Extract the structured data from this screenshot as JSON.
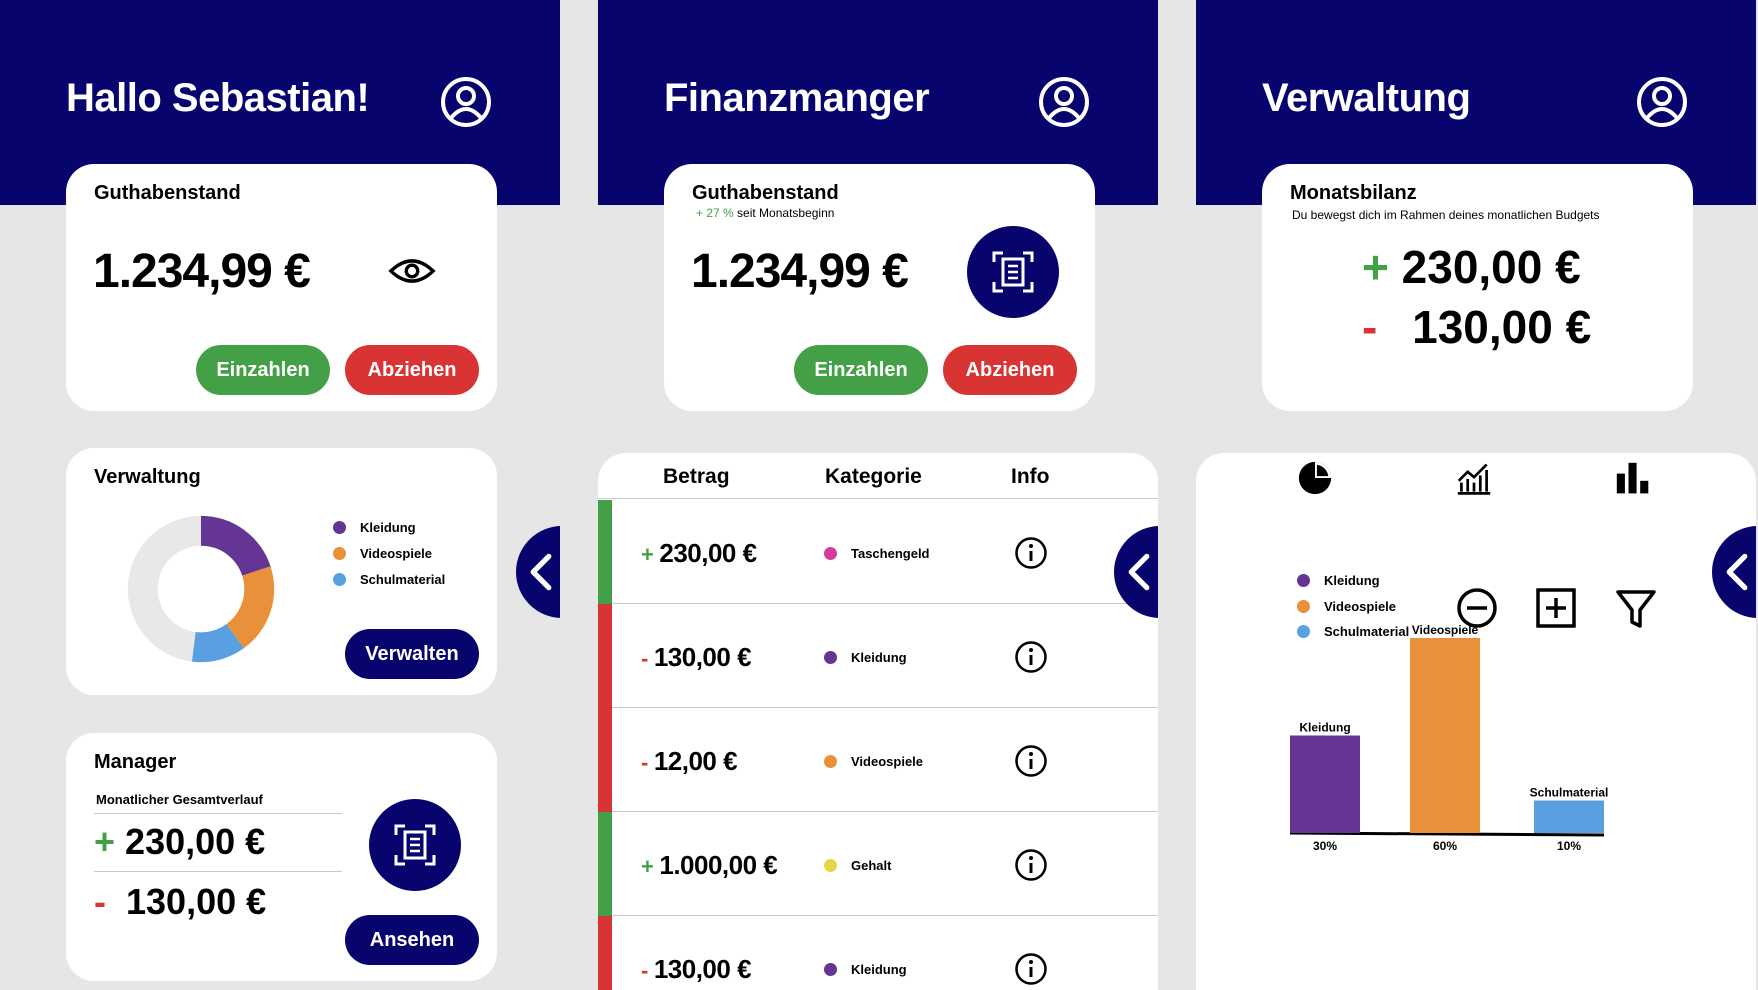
{
  "colors": {
    "navy": "#07046e",
    "green": "#43a047",
    "red": "#d93434",
    "purple": "#643594",
    "orange": "#e8913a",
    "blue": "#5aa0e0",
    "pink": "#d63a9c",
    "yellow": "#e5d745",
    "ring_bg": "#e8e8e8"
  },
  "screen1": {
    "title": "Hallo Sebastian!",
    "balance_card": {
      "title": "Guthabenstand",
      "amount": "1.234,99 €",
      "deposit_label": "Einzahlen",
      "withdraw_label": "Abziehen"
    },
    "admin_card": {
      "title": "Verwaltung",
      "legend": [
        {
          "label": "Kleidung",
          "color": "#643594"
        },
        {
          "label": "Videospiele",
          "color": "#e8913a"
        },
        {
          "label": "Schulmaterial",
          "color": "#5aa0e0"
        }
      ],
      "donut_fractions": [
        0.2,
        0.2,
        0.12
      ],
      "manage_label": "Verwalten"
    },
    "manager_card": {
      "title": "Manager",
      "subtitle": "Monatlicher Gesamtverlauf",
      "plus_sign": "+",
      "plus_amount": "230,00 €",
      "minus_sign": "-",
      "minus_amount": "130,00 €",
      "view_label": "Ansehen"
    }
  },
  "screen2": {
    "title": "Finanzmanger",
    "balance_card": {
      "title": "Guthabenstand",
      "change": "+ 27 %",
      "change_suffix": "seit Monatsbeginn",
      "amount": "1.234,99 €",
      "deposit_label": "Einzahlen",
      "withdraw_label": "Abziehen"
    },
    "table": {
      "headers": [
        "Betrag",
        "Kategorie",
        "Info"
      ],
      "rows": [
        {
          "sign": "+",
          "amount": "230,00 €",
          "category": "Taschengeld",
          "cat_color": "#d63a9c",
          "bar_color": "#43a047"
        },
        {
          "sign": "-",
          "amount": "130,00 €",
          "category": "Kleidung",
          "cat_color": "#643594",
          "bar_color": "#d93434"
        },
        {
          "sign": "-",
          "amount": "12,00 €",
          "category": "Videospiele",
          "cat_color": "#e8913a",
          "bar_color": "#d93434"
        },
        {
          "sign": "+",
          "amount": "1.000,00 €",
          "category": "Gehalt",
          "cat_color": "#e5d745",
          "bar_color": "#43a047"
        },
        {
          "sign": "-",
          "amount": "130,00 €",
          "category": "Kleidung",
          "cat_color": "#643594",
          "bar_color": "#d93434"
        }
      ]
    }
  },
  "screen3": {
    "title": "Verwaltung",
    "balance_card": {
      "title": "Monatsbilanz",
      "subtitle": "Du bewegst dich im Rahmen deines monatlichen Budgets",
      "plus_sign": "+",
      "plus_amount": "230,00 €",
      "minus_sign": "-",
      "minus_amount": "130,00 €"
    },
    "view_icons": [
      "pie-chart-icon",
      "line-chart-icon",
      "bar-chart-icon"
    ],
    "legend": [
      {
        "label": "Kleidung",
        "color": "#643594"
      },
      {
        "label": "Videospiele",
        "color": "#e8913a"
      },
      {
        "label": "Schulmaterial",
        "color": "#5aa0e0"
      }
    ],
    "actions": [
      "minus-circle-icon",
      "plus-square-icon",
      "filter-icon"
    ]
  },
  "chart_data": {
    "type": "bar",
    "categories": [
      "Kleidung",
      "Videospiele",
      "Schulmaterial"
    ],
    "values": [
      30,
      60,
      10
    ],
    "value_labels": [
      "30%",
      "60%",
      "10%"
    ],
    "colors": [
      "#643594",
      "#e8913a",
      "#5aa0e0"
    ],
    "title": "",
    "xlabel": "",
    "ylabel": "",
    "ylim": [
      0,
      60
    ]
  }
}
